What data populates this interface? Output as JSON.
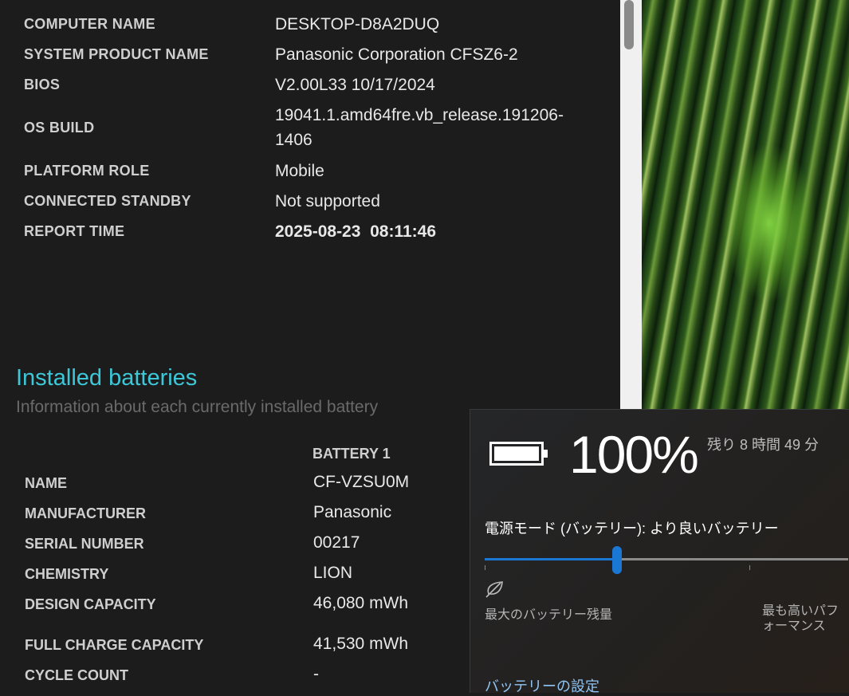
{
  "system_info": [
    {
      "label": "COMPUTER NAME",
      "value": "DESKTOP-D8A2DUQ"
    },
    {
      "label": "SYSTEM PRODUCT NAME",
      "value": "Panasonic Corporation CFSZ6-2"
    },
    {
      "label": "BIOS",
      "value": "V2.00L33 10/17/2024"
    },
    {
      "label": "OS BUILD",
      "value": "19041.1.amd64fre.vb_release.191206-",
      "value2": "1406"
    },
    {
      "label": "PLATFORM ROLE",
      "value": "Mobile"
    },
    {
      "label": "CONNECTED STANDBY",
      "value": "Not supported"
    },
    {
      "label": "REPORT TIME",
      "value": "2025-08-23  08:11:46"
    }
  ],
  "batteries": {
    "title": "Installed batteries",
    "subtitle": "Information about each currently installed battery",
    "column": "BATTERY 1",
    "rows": [
      {
        "label": "NAME",
        "value": "CF-VZSU0M"
      },
      {
        "label": "MANUFACTURER",
        "value": "Panasonic"
      },
      {
        "label": "SERIAL NUMBER",
        "value": "00217"
      },
      {
        "label": "CHEMISTRY",
        "value": "LION"
      },
      {
        "label": "DESIGN CAPACITY",
        "value": "46,080 mWh"
      },
      {
        "label": "FULL CHARGE CAPACITY",
        "value": "41,530 mWh"
      },
      {
        "label": "CYCLE COUNT",
        "value": "-"
      }
    ]
  },
  "flyout": {
    "percent": "100%",
    "remaining": "残り 8 時間 49 分",
    "power_mode": "電源モード (バッテリー): より良いバッテリー",
    "slider_value": 0.333,
    "slider_min_label": "最大のバッテリー残量",
    "slider_max_label": "最も高いパフォーマンス",
    "settings_link": "バッテリーの設定",
    "accent": "#1a78d4"
  }
}
